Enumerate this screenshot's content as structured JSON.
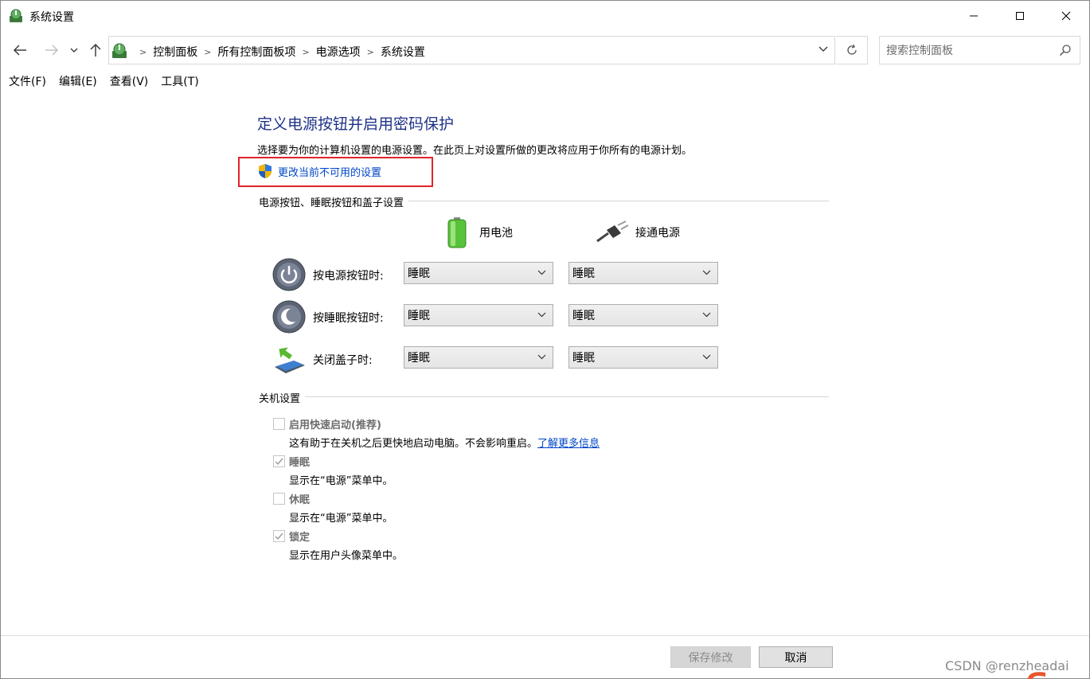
{
  "window": {
    "title": "系统设置"
  },
  "address": {
    "breadcrumbs": [
      "控制面板",
      "所有控制面板项",
      "电源选项",
      "系统设置"
    ],
    "search_placeholder": "搜索控制面板"
  },
  "menu": {
    "items": [
      "文件(F)",
      "编辑(E)",
      "查看(V)",
      "工具(T)"
    ]
  },
  "content": {
    "heading": "定义电源按钮并启用密码保护",
    "description": "选择要为你的计算机设置的电源设置。在此页上对设置所做的更改将应用于你所有的电源计划。",
    "change_link": "更改当前不可用的设置",
    "power_section_title": "电源按钮、睡眠按钮和盖子设置",
    "columns": {
      "battery": "用电池",
      "plugged": "接通电源"
    },
    "rows": [
      {
        "label": "按电源按钮时:",
        "battery": "睡眠",
        "plugged": "睡眠"
      },
      {
        "label": "按睡眠按钮时:",
        "battery": "睡眠",
        "plugged": "睡眠"
      },
      {
        "label": "关闭盖子时:",
        "battery": "睡眠",
        "plugged": "睡眠"
      }
    ],
    "shutdown_section_title": "关机设置",
    "shutdown_options": [
      {
        "label": "启用快速启动(推荐)",
        "checked": false,
        "desc": "这有助于在关机之后更快地启动电脑。不会影响重启。",
        "link": "了解更多信息"
      },
      {
        "label": "睡眠",
        "checked": true,
        "desc": "显示在“电源”菜单中。"
      },
      {
        "label": "休眠",
        "checked": false,
        "desc": "显示在“电源”菜单中。"
      },
      {
        "label": "锁定",
        "checked": true,
        "desc": "显示在用户头像菜单中。"
      }
    ]
  },
  "footer": {
    "save_label": "保存修改",
    "cancel_label": "取消"
  },
  "watermark": "CSDN @renzheadai",
  "colors": {
    "heading": "#1e3287",
    "link": "#0046c8",
    "highlight_box": "#e0242b"
  }
}
